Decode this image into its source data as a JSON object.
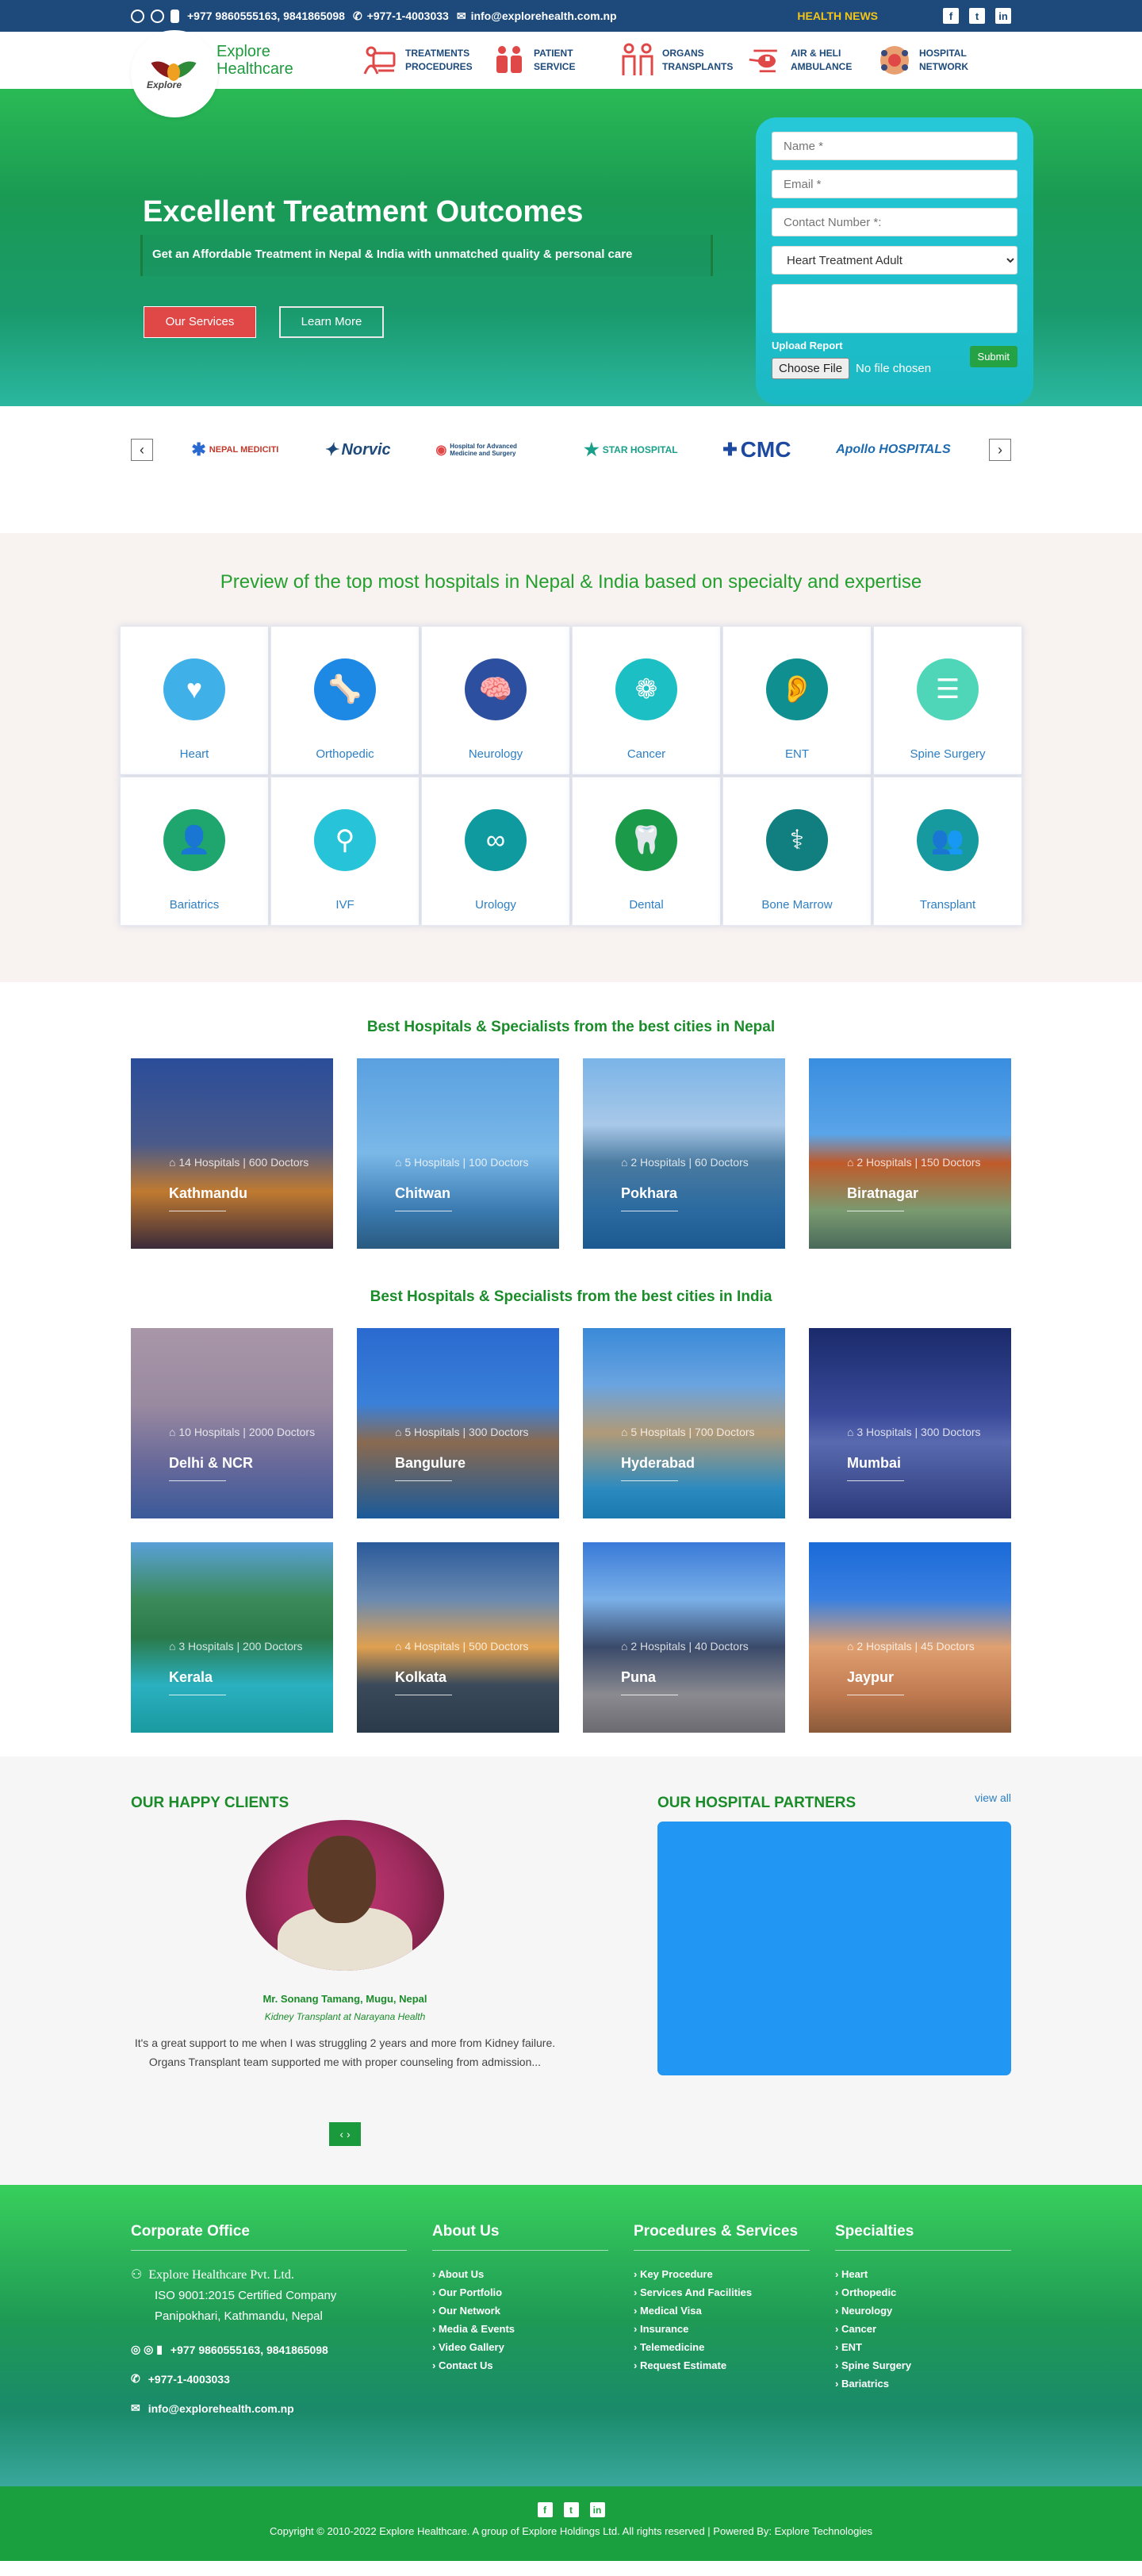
{
  "topbar": {
    "phones": "+977 9860555163, 9841865098",
    "landline": "+977-1-4003033",
    "email": "info@explorehealth.com.np",
    "news": "HEALTH NEWS"
  },
  "header": {
    "brand_line1": "Explore",
    "brand_line2": "Healthcare",
    "logo_text": "Explore",
    "nav": [
      {
        "line1": "TREATMENTS",
        "line2": "PROCEDURES",
        "icon": "doctor-computer-icon",
        "color": "#e04848"
      },
      {
        "line1": "PATIENT",
        "line2": "SERVICE",
        "icon": "patient-icon",
        "color": "#e04848"
      },
      {
        "line1": "ORGANS",
        "line2": "TRANSPLANTS",
        "icon": "organs-icon",
        "color": "#e04848"
      },
      {
        "line1": "AIR & HELI",
        "line2": "AMBULANCE",
        "icon": "helicopter-icon",
        "color": "#e04848"
      },
      {
        "line1": "HOSPITAL",
        "line2": "NETWORK",
        "icon": "network-icon",
        "color": "#e04848"
      }
    ]
  },
  "hero": {
    "title": "Excellent Treatment Outcomes",
    "subtitle": "Get an Affordable Treatment in Nepal & India with unmatched quality & personal care",
    "btn_services": "Our Services",
    "btn_learn": "Learn More"
  },
  "form": {
    "name_ph": "Name *",
    "email_ph": "Email *",
    "contact_ph": "Contact Number *:",
    "treatment": "Heart Treatment Adult",
    "upload_label": "Upload Report",
    "choose_file": "Choose File",
    "no_file": "No file chosen",
    "submit": "Submit"
  },
  "partners": [
    "NEPAL MEDICITI",
    "Norvic",
    "Hospital for Advanced Medicine and Surgery",
    "STAR HOSPITAL",
    "CMC",
    "Apollo HOSPITALS"
  ],
  "specialties": {
    "heading": "Preview of the top most hospitals in Nepal & India based on specialty and expertise",
    "items": [
      {
        "label": "Heart",
        "icon": "heart-icon",
        "glyph": "♥",
        "color": "#3fb0e8"
      },
      {
        "label": "Orthopedic",
        "icon": "knee-icon",
        "glyph": "🦴",
        "color": "#1e88e5"
      },
      {
        "label": "Neurology",
        "icon": "brain-icon",
        "glyph": "🧠",
        "color": "#2d4fa0"
      },
      {
        "label": "Cancer",
        "icon": "cancer-hands-icon",
        "glyph": "❁",
        "color": "#1bbfc4"
      },
      {
        "label": "ENT",
        "icon": "ear-icon",
        "glyph": "👂",
        "color": "#0f8f8f"
      },
      {
        "label": "Spine Surgery",
        "icon": "spine-icon",
        "glyph": "☰",
        "color": "#4fd6b8"
      },
      {
        "label": "Bariatrics",
        "icon": "body-icon",
        "glyph": "👤",
        "color": "#1ea66e"
      },
      {
        "label": "IVF",
        "icon": "uterus-icon",
        "glyph": "⚲",
        "color": "#27c4d9"
      },
      {
        "label": "Urology",
        "icon": "kidney-icon",
        "glyph": "∞",
        "color": "#0f9aa0"
      },
      {
        "label": "Dental",
        "icon": "tooth-icon",
        "glyph": "🦷",
        "color": "#1b9a4a"
      },
      {
        "label": "Bone Marrow",
        "icon": "bone-icon",
        "glyph": "⚕",
        "color": "#117f7f"
      },
      {
        "label": "Transplant",
        "icon": "transplant-icon",
        "glyph": "👥",
        "color": "#169aa0"
      }
    ]
  },
  "nepal": {
    "heading": "Best Hospitals & Specialists from the best cities in Nepal",
    "cities": [
      {
        "name": "Kathmandu",
        "meta": "14 Hospitals | 600 Doctors",
        "bg": "linear-gradient(180deg,#2a4d9a 0%,#4a5a8a 45%,#c07a30 70%,#3a2a3a 100%)"
      },
      {
        "name": "Chitwan",
        "meta": "5 Hospitals | 100 Doctors",
        "bg": "linear-gradient(180deg,#5aa0e0 0%,#7ab8e8 50%,#3a7ab0 80%,#2a5a80 100%)"
      },
      {
        "name": "Pokhara",
        "meta": "2 Hospitals | 60 Doctors",
        "bg": "linear-gradient(180deg,#7ab4e8 0%,#a8c8e8 35%,#4a7aa0 55%,#2a6aa0 80%,#1a5a90 100%)"
      },
      {
        "name": "Biratnagar",
        "meta": "2 Hospitals | 150 Doctors",
        "bg": "linear-gradient(180deg,#3a8ee0 0%,#5aa4e8 40%,#c05a2a 55%,#7a9a70 80%,#4a6a5a 100%)"
      }
    ]
  },
  "india": {
    "heading": "Best Hospitals & Specialists from the best cities in India",
    "cities": [
      {
        "name": "Delhi & NCR",
        "meta": "10 Hospitals | 2000 Doctors",
        "bg": "linear-gradient(180deg,#a896a8 0%,#9a8aa0 40%,#6a6a9a 70%,#3a5a9a 100%)"
      },
      {
        "name": "Bangulure",
        "meta": "5 Hospitals | 300 Doctors",
        "bg": "linear-gradient(180deg,#2a6ad0 0%,#3a80d8 40%,#8a6a50 60%,#1a5a9a 100%)"
      },
      {
        "name": "Hyderabad",
        "meta": "5 Hospitals | 700 Doctors",
        "bg": "linear-gradient(180deg,#3a8ad8 0%,#6aa4e0 30%,#b09a78 55%,#2a8ac0 85%,#1a7ab0 100%)"
      },
      {
        "name": "Mumbai",
        "meta": "3 Hospitals | 300 Doctors",
        "bg": "linear-gradient(180deg,#1a2a6a 0%,#3a4a9a 45%,#5a6ab0 60%,#2a3a7a 100%)"
      },
      {
        "name": "Kerala",
        "meta": "3 Hospitals | 200 Doctors",
        "bg": "linear-gradient(180deg,#5aa0d8 0%,#3a8a5a 30%,#2a7a4a 50%,#2ab0c0 75%,#1a9aa0 100%)"
      },
      {
        "name": "Kolkata",
        "meta": "4 Hospitals | 500 Doctors",
        "bg": "linear-gradient(180deg,#2a5a9a 0%,#6a8ab0 30%,#e0a050 55%,#3a4a5a 75%,#2a3a4a 100%)"
      },
      {
        "name": "Puna",
        "meta": "2 Hospitals | 40 Doctors",
        "bg": "linear-gradient(180deg,#3a7ad8 0%,#7ab0e8 30%,#3a4a6a 55%,#8a8a90 80%,#6a6a70 100%)"
      },
      {
        "name": "Jaypur",
        "meta": "2 Hospitals | 45 Doctors",
        "bg": "linear-gradient(180deg,#1a6ad8 0%,#3a80e0 30%,#e0a070 55%,#c07a50 80%,#8a5a3a 100%)"
      }
    ]
  },
  "clients": {
    "heading": "OUR HAPPY CLIENTS",
    "name": "Mr. Sonang Tamang, Mugu, Nepal",
    "sub": "Kidney Transplant at Narayana Health",
    "text": "It's a great support to me when I was struggling 2 years and more from Kidney failure. Organs Transplant team supported me with proper counseling from admission..."
  },
  "hospital_partners": {
    "heading": "OUR HOSPITAL PARTNERS",
    "view_all": "view all"
  },
  "footer": {
    "office_heading": "Corporate Office",
    "company": "Explore Healthcare Pvt. Ltd.",
    "iso": "ISO 9001:2015 Certified Company",
    "address": "Panipokhari, Kathmandu, Nepal",
    "phones": "+977 9860555163, 9841865098",
    "landline": "+977-1-4003033",
    "email": "info@explorehealth.com.np",
    "about_heading": "About Us",
    "about": [
      "About Us",
      "Our Portfolio",
      "Our Network",
      "Media & Events",
      "Video Gallery",
      "Contact Us"
    ],
    "proc_heading": "Procedures & Services",
    "proc": [
      "Key Procedure",
      "Services And Facilities",
      "Medical Visa",
      "Insurance",
      "Telemedicine",
      "Request Estimate"
    ],
    "spec_heading": "Specialties",
    "spec": [
      "Heart",
      "Orthopedic",
      "Neurology",
      "Cancer",
      "ENT",
      "Spine Surgery",
      "Bariatrics"
    ],
    "copyright": "Copyright © 2010-2022 Explore Healthcare. A group of Explore Holdings Ltd. All rights reserved | Powered By: Explore Technologies"
  },
  "colors": {
    "primary_green": "#1f9a3e",
    "navy": "#1d4a7a",
    "accent_red": "#e04848",
    "cyan_form": "#1acdd6"
  }
}
